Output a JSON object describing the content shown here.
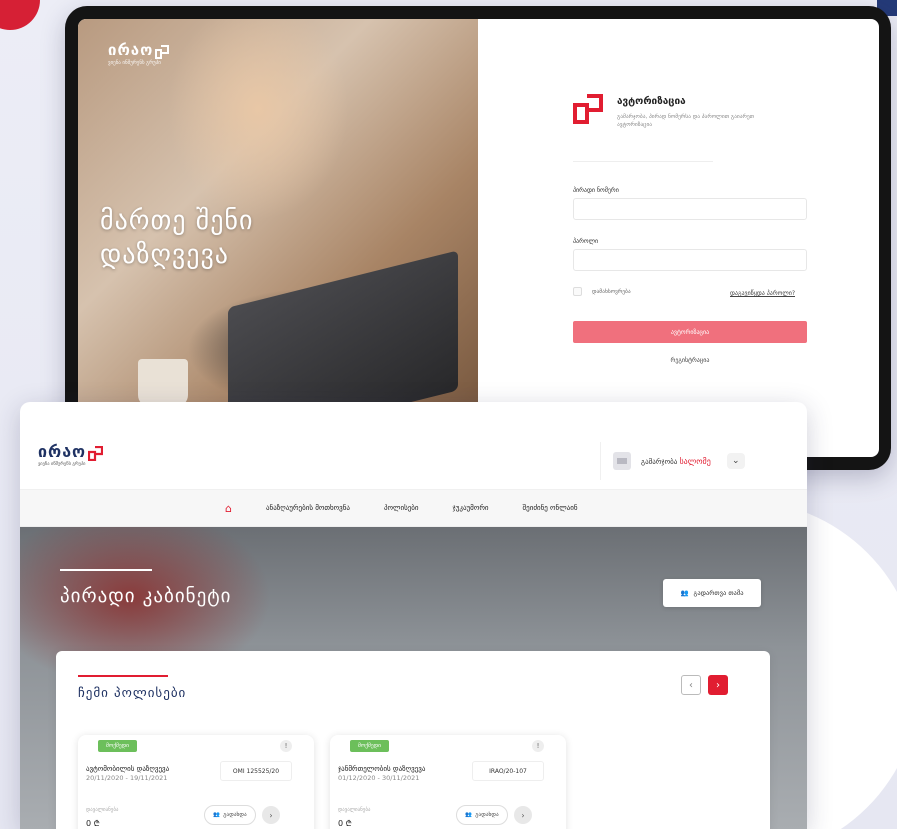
{
  "login": {
    "logo_word": "ირაო",
    "logo_sub": "ვიენა ინშურენს გრუპი",
    "hero_line1": "მართე შენი",
    "hero_line2": "დაზღვევა",
    "title": "ავტორიზაცია",
    "subtitle": "გამარჯობა, პირად ნომერსა და პაროლით გაიარეთ ავტორიზაცია",
    "id_label": "პირადი ნომერი",
    "password_label": "პაროლი",
    "remember_label": "დამახსოვრება",
    "forgot_link": "დაგავიწყდა პაროლი?",
    "login_button": "ავტორიზაცია",
    "register_link": "რეგისტრაცია",
    "button_color": "#f0707d"
  },
  "dashboard": {
    "logo_word": "ირაო",
    "logo_sub": "ვიენა ინშურენს გრუპი",
    "greeting": "გამარჯობა",
    "user_name": "სალომე",
    "nav": [
      "ანაზღაურების მოთხოვნა",
      "პოლისები",
      "ჯუკაუმორი",
      "შეიძინე ონლაინ"
    ],
    "hero_title": "პირადი კაბინეტი",
    "profile_button": "გადართვა თამა",
    "policies_title": "ჩემი პოლისები",
    "accent": "#e11d31",
    "brand": "#1f3263",
    "policies": [
      {
        "status": "მოქმედი",
        "type": "ავტომობილის დაზღვევა",
        "dates": "20/11/2020 - 19/11/2021",
        "number": "OMI 125525/20",
        "amount_label": "დავალიანება",
        "amount": "0 ₾",
        "details": "გადახდა"
      },
      {
        "status": "მოქმედი",
        "type": "ჯანმრთელობის დაზღვევა",
        "dates": "01/12/2020 - 30/11/2021",
        "number": "IRAO/20-107",
        "amount_label": "დავალიანება",
        "amount": "0 ₾",
        "details": "გადახდა"
      }
    ]
  }
}
